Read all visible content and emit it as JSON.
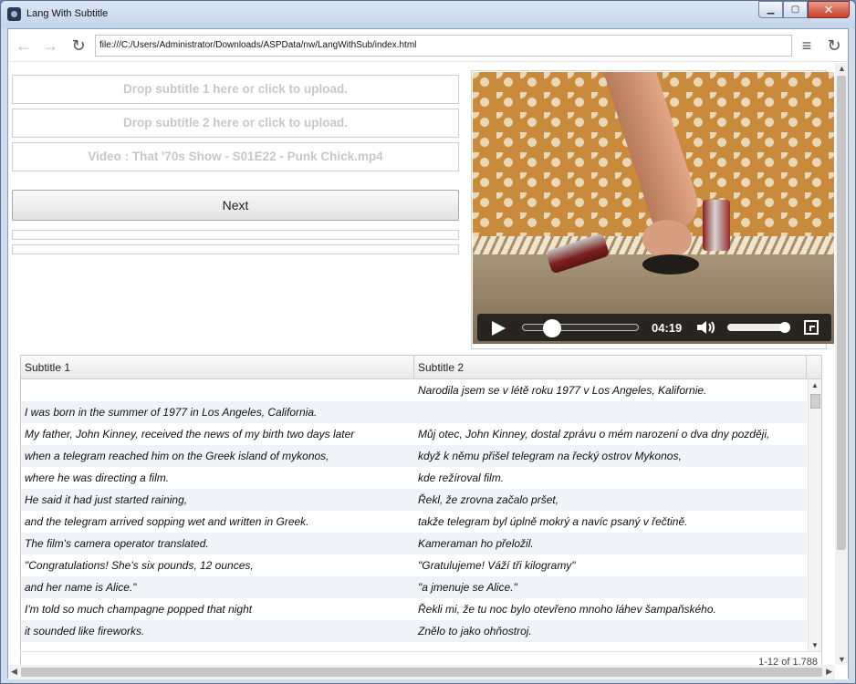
{
  "window": {
    "title": "Lang With Subtitle"
  },
  "toolbar": {
    "back": "←",
    "forward": "→",
    "reload": "↻",
    "menu": "≡",
    "refresh": "↻",
    "address": "file:///C:/Users/Administrator/Downloads/ASPData/nw/LangWithSub/index.html"
  },
  "dropzones": {
    "subtitle1": "Drop subtitle 1 here or click to upload.",
    "subtitle2": "Drop subtitle 2 here or click to upload.",
    "video": "Video : That '70s Show - S01E22 - Punk Chick.mp4"
  },
  "next_button": {
    "label": "Next"
  },
  "progress": {
    "bar1": 0,
    "bar2": 0
  },
  "video": {
    "time": "04:19",
    "seek_fraction": 0.25,
    "volume_fraction": 0.95
  },
  "grid": {
    "headers": [
      "Subtitle 1",
      "Subtitle 2"
    ],
    "rows": [
      [
        "",
        "Narodila jsem se v létě roku 1977 v Los Angeles, Kalifornie."
      ],
      [
        "I was born in the summer of 1977 in Los Angeles, California.",
        ""
      ],
      [
        "My father, John Kinney, received the news of my birth two days later",
        "Můj otec, John Kinney, dostal zprávu o mém narození o dva dny později,"
      ],
      [
        "when a telegram reached him on the Greek island of mykonos,",
        "když k němu přišel telegram na řecký ostrov Mykonos,"
      ],
      [
        "where he was directing a film.",
        "kde režíroval film."
      ],
      [
        "He said it had just started raining,",
        "Řekl, že zrovna začalo pršet,"
      ],
      [
        "and the telegram arrived sopping wet and written in Greek.",
        "takže telegram byl úplně mokrý a navíc psaný v řečtině."
      ],
      [
        "The film's camera operator translated.",
        "Kameraman ho přeložil."
      ],
      [
        "\"Congratulations! She's six pounds, 12 ounces,",
        "\"Gratulujeme! Váží tři kilogramy\""
      ],
      [
        "and her name is Alice.\"",
        "\"a jmenuje se Alice.\""
      ],
      [
        "I'm told so much champagne popped that night",
        "Řekli mi, že tu noc bylo otevřeno mnoho láhev šampaňského."
      ],
      [
        "it sounded like fireworks.",
        "Znělo to jako ohňostroj."
      ]
    ],
    "count": "1-12 of 1,788"
  }
}
